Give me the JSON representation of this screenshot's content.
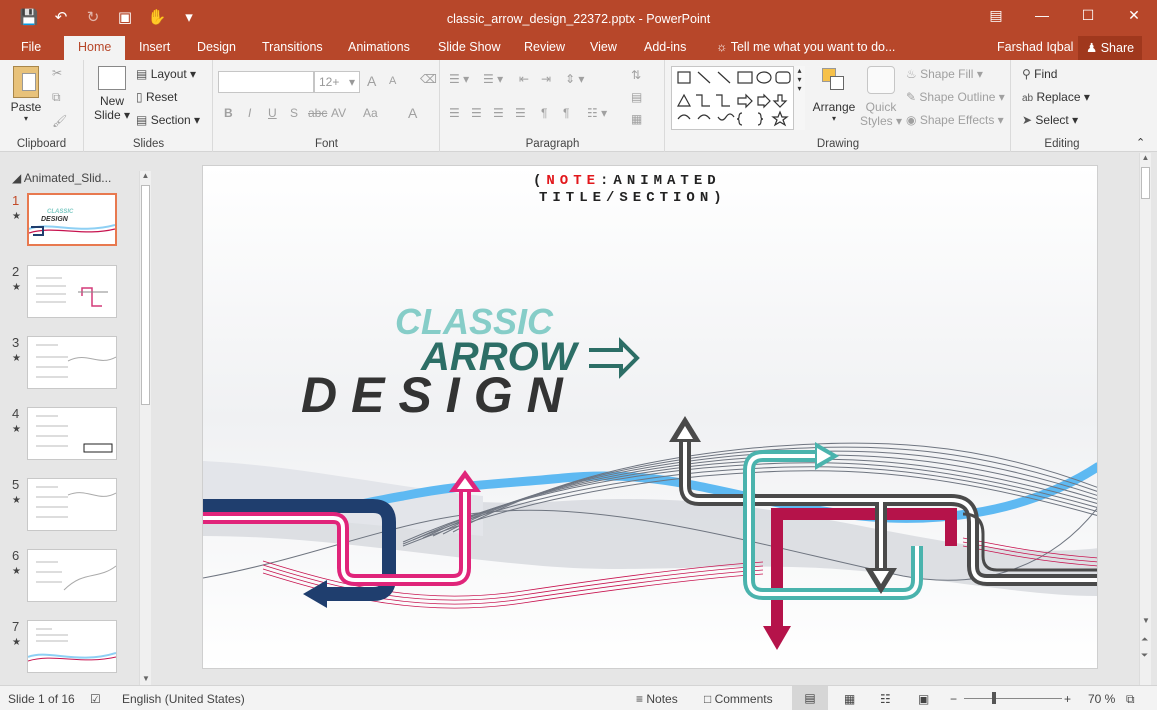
{
  "window": {
    "title": "classic_arrow_design_22372.pptx - PowerPoint",
    "accent_color": "#b7472a"
  },
  "qat": [
    "save-icon",
    "undo-icon",
    "redo-icon",
    "present-icon",
    "touch-icon",
    "customize-icon"
  ],
  "tabs": [
    "File",
    "Home",
    "Insert",
    "Design",
    "Transitions",
    "Animations",
    "Slide Show",
    "Review",
    "View",
    "Add-ins"
  ],
  "tellme": "Tell me what you want to do...",
  "user": "Farshad Iqbal",
  "share": "Share",
  "ribbon": {
    "clipboard": {
      "label": "Clipboard",
      "paste": "Paste"
    },
    "slides": {
      "label": "Slides",
      "new_slide": "New",
      "new_slide2": "Slide",
      "layout": "Layout",
      "reset": "Reset",
      "section": "Section"
    },
    "font": {
      "label": "Font",
      "size": "12+",
      "bold": "B",
      "italic": "I",
      "underline": "U",
      "shadow": "S",
      "strike": "abc",
      "spacing": "AV",
      "case": "Aa",
      "color": "A",
      "grow": "A",
      "shrink": "A"
    },
    "paragraph": {
      "label": "Paragraph"
    },
    "drawing": {
      "label": "Drawing",
      "arrange": "Arrange",
      "quick_styles": "Quick",
      "quick_styles2": "Styles",
      "shape_fill": "Shape Fill",
      "shape_outline": "Shape Outline",
      "shape_effects": "Shape Effects"
    },
    "editing": {
      "label": "Editing",
      "find": "Find",
      "replace": "Replace",
      "select": "Select"
    }
  },
  "thumbs": {
    "section": "Animated_Slid...",
    "items": [
      "1",
      "2",
      "3",
      "4",
      "5",
      "6",
      "7"
    ]
  },
  "slide": {
    "note_open": "(",
    "note_word": "NOTE",
    "note_rest": ":ANIMATED",
    "note_line2": "TITLE/SECTION)",
    "classic": "CLASSIC",
    "arrow": "ARROW",
    "design": "DESIGN"
  },
  "status": {
    "slide": "Slide 1 of 16",
    "language": "English (United States)",
    "notes": "Notes",
    "comments": "Comments",
    "zoom": "70 %"
  }
}
